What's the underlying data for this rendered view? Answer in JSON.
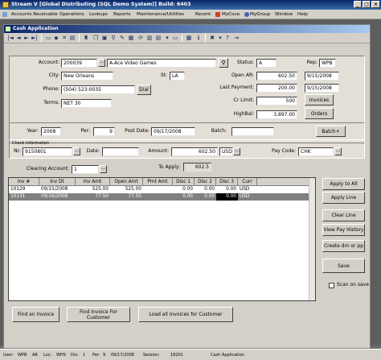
{
  "window": {
    "title": "Stream V  [Global Distributing (SQL Demo System)]  Build: 6403"
  },
  "menu": [
    "Accounts Receivable",
    "Operations",
    "Lookups",
    "Reports",
    "Maintenance/Utilities",
    "Recent",
    "MyCove",
    "MyGroup",
    "Window",
    "Help"
  ],
  "child": {
    "title": "Cash Application"
  },
  "customer": {
    "account_label": "Account:",
    "account": "200039",
    "name": "A-Ace Video Games",
    "city_label": "City:",
    "city": "New Orleans",
    "st_label": "St:",
    "st": "LA",
    "phone_label": "Phone:",
    "phone": "(504) 523-0035",
    "dial": "Dial",
    "terms_label": "Terms:",
    "terms": "NET 30",
    "status_label": "Status:",
    "status": "A",
    "rep_label": "Rep:",
    "rep": "WPB",
    "open_ar_label": "Open AR:",
    "open_ar": "602.50",
    "open_ar_date": "9/15/2008",
    "last_payment_label": "Last Payment:",
    "last_payment": "200.00",
    "last_payment_date": "9/15/2008",
    "cr_limit_label": "Cr Limit:",
    "cr_limit": "500",
    "invoices_btn": "Invoices",
    "highbal_label": "HighBal:",
    "highbal": "3,897.00",
    "orders_btn": "Orders"
  },
  "period": {
    "year_label": "Year:",
    "year": "2008",
    "per_label": "Per:",
    "per": "9",
    "post_date_label": "Post Date:",
    "post_date": "09/17/2008",
    "batch_label": "Batch:",
    "batch": "",
    "batch_btn": "Batch+"
  },
  "check": {
    "section_label": "Check Information",
    "nr_label": "Nr:",
    "nr": "9150801",
    "date_label": "Date:",
    "date": "",
    "amount_label": "Amount:",
    "amount": "602.50",
    "currency": "USD",
    "pay_code_label": "Pay Code:",
    "pay_code": "CHK"
  },
  "clearing": {
    "label": "Clearing Account:",
    "value": "1",
    "to_apply_label": "To Apply:",
    "to_apply": "602.5"
  },
  "grid": {
    "columns": [
      "Inv #",
      "Inv Dt",
      "Inv Amt",
      "Open Amt",
      "Pmt Amt",
      "Disc 1",
      "Disc 2",
      "Disc 3",
      "Curr"
    ],
    "rows": [
      [
        "10129",
        "09/15/2008",
        "525.00",
        "525.00",
        "",
        "0.00",
        "0.00",
        "0.00",
        "USD"
      ],
      [
        "10131",
        "09/16/2008",
        "77.50",
        "77.50",
        "",
        "0.00",
        "0.00",
        "0.00",
        "USD"
      ]
    ]
  },
  "side_buttons": {
    "apply_to_all": "Apply to All",
    "apply_line": "Apply Line",
    "clear_line": "Clear Line",
    "view_pay_history": "View Pay History",
    "create_dm": "Create dm or pp",
    "save": "Save",
    "scan_on_save": "Scan on save"
  },
  "bottom_buttons": {
    "find_invoice": "Find an Invoice",
    "find_invoice_customer": "Find Invoice For Customer",
    "load_all": "Load all Invoices for Customer"
  },
  "statusbar": {
    "user_label": "User:",
    "user": "WPB",
    "ar_label": "AR",
    "loc_label": "Loc:",
    "whs": "WHS",
    "div_label": "Div:",
    "div": "1",
    "per_label": "Per:",
    "per": "9",
    "date": "09/17/2008",
    "session_label": "Session:",
    "session": "18201",
    "screen": "Cash Application"
  },
  "colors": {
    "title_bar": "#0a246a",
    "selected_row": "#808080",
    "selected_cell": "#000000",
    "face": "#d4d0c8"
  }
}
